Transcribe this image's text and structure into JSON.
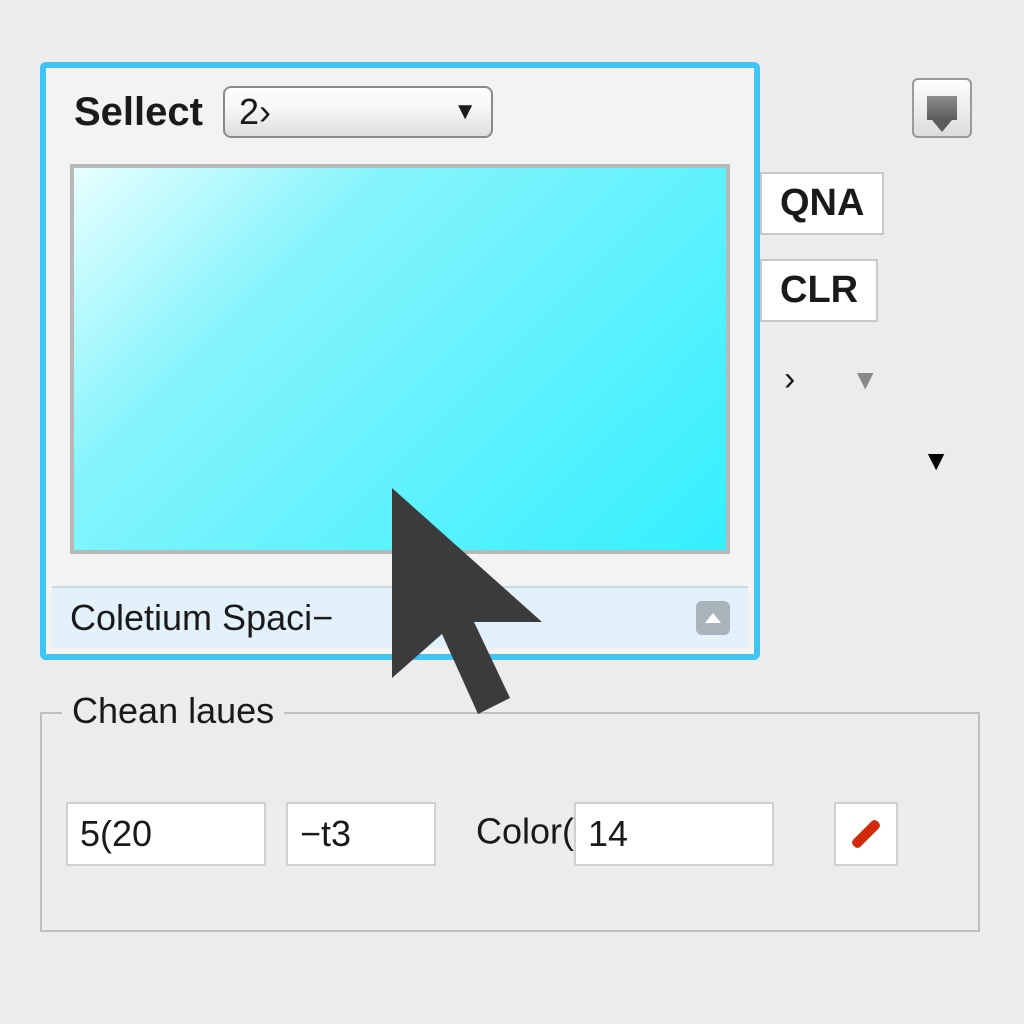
{
  "main_panel": {
    "select_label": "Sellect",
    "select_value": "2›",
    "status_text": "Coletium Spaci−"
  },
  "side": {
    "btn_qna": "QNA",
    "btn_clr": "CLR",
    "stub_char": "›"
  },
  "group": {
    "title": "Chean laues",
    "field1": "5(20",
    "field2": "−t3",
    "color_label_prefix": "Color(",
    "color_value": "14"
  },
  "icons": {
    "save": "save-icon",
    "dropdown": "▼",
    "dropdown_light": "▼",
    "collapse": "▲"
  }
}
